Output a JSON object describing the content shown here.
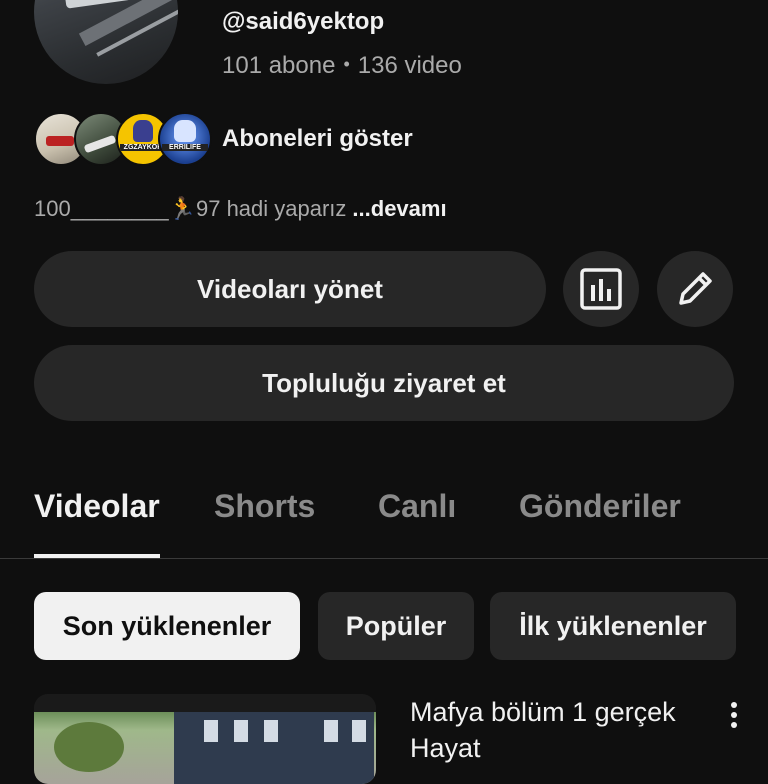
{
  "channel": {
    "handle": "@said6yektop",
    "subscribers": "101 abone",
    "separator": "•",
    "video_count": "136 video",
    "show_subscribers_label": "Aboneleri göster",
    "subscriber_avatar_tags": [
      "",
      "",
      "ZGZAYKOK",
      "ERRILIFE"
    ],
    "description": "100________🏃97 hadi yaparız",
    "description_more": "...devamı"
  },
  "actions": {
    "manage_videos": "Videoları yönet",
    "visit_community": "Topluluğu ziyaret et",
    "analytics_icon": "analytics-icon",
    "edit_icon": "pencil-icon"
  },
  "tabs": [
    {
      "label": "Videolar",
      "active": true
    },
    {
      "label": "Shorts",
      "active": false
    },
    {
      "label": "Canlı",
      "active": false
    },
    {
      "label": "Gönderiler",
      "active": false
    }
  ],
  "filters": [
    {
      "label": "Son yüklenenler",
      "active": true
    },
    {
      "label": "Popüler",
      "active": false
    },
    {
      "label": "İlk yüklenenler",
      "active": false
    }
  ],
  "videos": [
    {
      "title": "Mafya bölüm 1 gerçek Hayat"
    }
  ],
  "colors": {
    "background": "#0f0f0f",
    "surface": "#272727",
    "text_primary": "#f1f1f1",
    "text_secondary": "#aaaaaa"
  }
}
